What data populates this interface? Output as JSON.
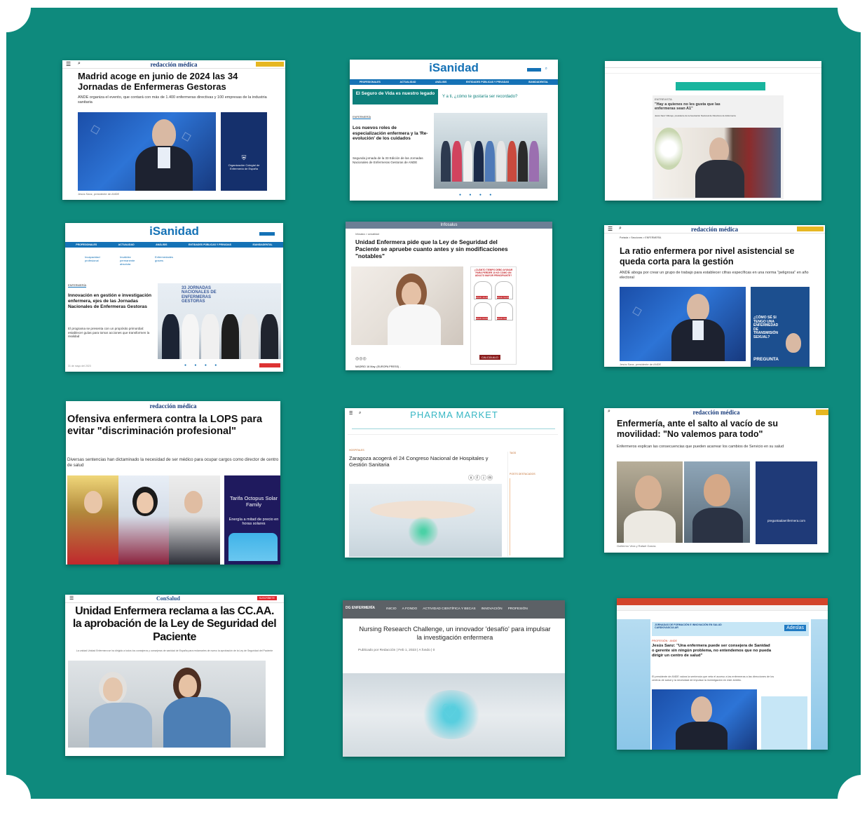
{
  "cards": {
    "c1": {
      "site": "redacción médica",
      "title": "Madrid acoge en junio de 2024 las 34 Jornadas de Enfermeras Gestoras",
      "subtitle": "ANDE organiza el evento, que contará con más de 1.400 enfermeras directivas y 100 empresas de la industria sanitaria",
      "caption": "Jesús Sanz, presidente de ANDE",
      "ad_text": "Organización Colegial de Enfermería de España"
    },
    "c2": {
      "site": "iSanidad",
      "nav": [
        "PROFESIONALES",
        "ACTUALIDAD",
        "ANÁLISIS",
        "ENTIDADES PÚBLICAS Y PRIVADAS",
        "ISANIDADENTAL"
      ],
      "banner": "El Seguro de Vida es nuestro legado",
      "banner_right": "Y a ti, ¿cómo te gustaría ser recordado?",
      "section": "ENFERMERÍA",
      "title": "Los nuevos roles de especialización enfermera y la 'Re-evolución' de los cuidados",
      "subtitle": "Segunda jornada de la 33 Edición de las Jornadas Nacionales de Enfermeras Gestoras de ANDE"
    },
    "c3": {
      "section": "ENTREVISTA",
      "title": "\"Hay a quienes no les gusta que las enfermeras sean A1\"",
      "subtitle": "Jesús Sanz Villorejo, presidente de la Asociación Nacional de Directivos de Enfermería"
    },
    "c4": {
      "site": "iSanidad",
      "nav": [
        "PROFESIONALES",
        "ACTUALIDAD",
        "ANÁLISIS",
        "ENTIDADES PÚBLICAS Y PRIVADAS",
        "ISANIDADENTAL"
      ],
      "links": [
        "Incapacidad profesional",
        "Invalidez permanente absoluta",
        "Enfermedades graves"
      ],
      "section": "ENFERMERÍA",
      "title": "Innovación en gestión e investigación enfermera, ejes de las Jornadas Nacionales de Enfermeras Gestoras",
      "subtitle": "El programa se presenta con un propósito primordial: establecer guías para tomar acciones que transformen la realidad",
      "date": "31 de mayo del 2023",
      "banner": "33 JORNADAS NACIONALES DE ENFERMERAS GESTORAS"
    },
    "c5": {
      "site": "Infosalus",
      "crumb": "Infosalus > actualidad",
      "title": "Unidad Enfermera pide que la Ley de Seguridad del Paciente se apruebe cuanto antes y sin modificaciones \"notables\"",
      "ad_title": "¿CUÁNTO TIEMPO DEBO AYUNAR PARA PERDER 10 KG COMO UN ADULTO MAYOR PRINCIPIANTE?",
      "ages": [
        "EDAD 40-49",
        "EDAD 50-59",
        "EDAD 60-69",
        "EDAD 69+"
      ],
      "ad_button": "CALCÚLALO",
      "dateline": "MADRID 16 May. (EUROPA PRESS) -"
    },
    "c6": {
      "site": "redacción médica",
      "crumb": "Portada > Secciones > ENFERMERÍA",
      "title": "La ratio enfermera por nivel asistencial se queda corta para la gestión",
      "subtitle": "ANDE aboga por crear un grupo de trabajo para establecer cifras específicas en una norma \"peligrosa\" en año electoral",
      "ad_text": "¿CÓMO SÉ SI TENGO UNA ENFERMEDAD DE TRANSMISIÓN SEXUAL?",
      "ad_bottom": "PREGUNTA",
      "caption": "Jesús Sanz, presidente de ANDE"
    },
    "c7": {
      "site": "redacción médica",
      "title": "Ofensiva enfermera contra la LOPS para evitar \"discriminación profesional\"",
      "subtitle": "Diversas sentencias han dictaminado la necesidad de ser médico para ocupar cargos como director de centro de salud",
      "ad_title": "Tarifa Octopus Solar Family",
      "ad_text": "Energía a mitad de precio en horas solares"
    },
    "c8": {
      "site": "PHARMA MARKET",
      "section": "HOSPITALES",
      "title": "Zaragoza acogerá el 24 Congreso Nacional de Hospitales y Gestión Sanitaria",
      "side_head": "POSTS DESTACADOS",
      "tags_head": "TAGS"
    },
    "c9": {
      "site": "redacción médica",
      "title": "Enfermería, ante el salto al vacío de su movilidad: \"No valemos para todo\"",
      "subtitle": "Enfermeros explican las consecuencias que pueden acarrear los cambios de Servicio en su salud",
      "caption": "Guillermo Vera y Rafael García.",
      "ad_text": "preguntaalaenfermera.com"
    },
    "c10": {
      "site": "ConSalud",
      "title": "Unidad Enfermera reclama a las CC.AA. la aprobación de la Ley de Seguridad del Paciente",
      "subtitle": "La unidad Unidad Enfermera se ha dirigido a todos los consejeros y consejeras de sanidad de España para reclamarles de nuevo la aprobación de la Ley de Seguridad del Paciente",
      "button": "SUSCRÍBETE"
    },
    "c11": {
      "site": "DG ENFERMERÍA",
      "nav": [
        "INICIO",
        "A FONDO",
        "ACTIVIDAD CIENTÍFICA Y BECAS",
        "INNOVACIÓN",
        "PROFESIÓN"
      ],
      "title": "Nursing Research Challenge, un innovador 'desafío' para impulsar la investigación enfermera",
      "meta": "Publicado por Redacción | Feb 1, 2023 | A fondo | 0"
    },
    "c12": {
      "section": "PROFESIÓN · ANDE",
      "title": "Jesús Sanz: \"Una enfermera puede ser consejera de Sanidad o gerente sin ningún problema, no entendemos que no pueda dirigir un centro de salud\"",
      "subtitle": "El presidente de ANDE valora la sentencia que veta el acceso a las enfermeras a las direcciones de los centros de salud y la necesidad de impulsar la investigación en este ámbito.",
      "ad_title": "JORNADAS DE FORMACIÓN E INNOVACIÓN EN SALUD CARDIOVASCULAR",
      "ad_brand": "Adeslas"
    }
  },
  "colors": {
    "board": "#0e8a7d",
    "rm_blue": "#1a3d7c",
    "isanidad_blue": "#1572b6",
    "consalud_red": "#e3262d"
  }
}
